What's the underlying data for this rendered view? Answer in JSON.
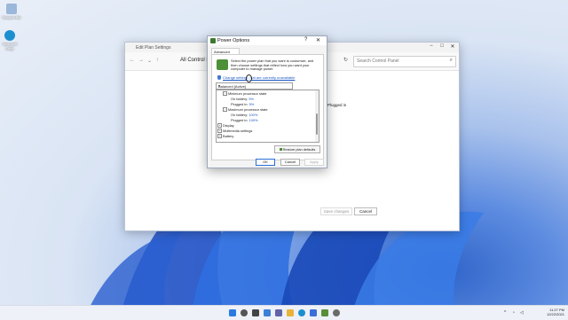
{
  "desktop": {
    "icons": [
      {
        "label": "Recycle Bin",
        "color": "#9bb7d9"
      },
      {
        "label": "Microsoft Edge",
        "color": "#1c8fd0"
      }
    ]
  },
  "control_panel": {
    "title": "Edit Plan Settings",
    "breadcrumb": "All Control P",
    "search_placeholder": "Search Control Panel",
    "plugged_in_label": "Plugged in",
    "save_label": "Save changes",
    "cancel_label": "Cancel"
  },
  "dialog": {
    "title": "Power Options",
    "help": "?",
    "close": "✕",
    "tab": "Advanced settings",
    "description": "Select the power plan that you want to customize, and then choose settings that reflect how you want your computer to manage power.",
    "change_link": "Change settings that are currently unavailable",
    "plan_selected": "Balanced [Active]",
    "tree": [
      {
        "label": "Minimum processor state",
        "indent": 1,
        "expander": "−",
        "value": ""
      },
      {
        "label": "On battery:",
        "indent": 2,
        "expander": "",
        "value": "5%"
      },
      {
        "label": "Plugged in:",
        "indent": 2,
        "expander": "",
        "value": "5%"
      },
      {
        "label": "Maximum processor state",
        "indent": 1,
        "expander": "−",
        "value": ""
      },
      {
        "label": "On battery:",
        "indent": 2,
        "expander": "",
        "value": "100%"
      },
      {
        "label": "Plugged in:",
        "indent": 2,
        "expander": "",
        "value": "100%"
      },
      {
        "label": "Display",
        "indent": 0,
        "expander": "+",
        "value": ""
      },
      {
        "label": "Multimedia settings",
        "indent": 0,
        "expander": "+",
        "value": ""
      },
      {
        "label": "Battery",
        "indent": 0,
        "expander": "+",
        "value": ""
      }
    ],
    "restore_label": "Restore plan defaults",
    "ok_label": "OK",
    "cancel_label": "Cancel",
    "apply_label": "Apply"
  },
  "taskbar": {
    "apps": [
      {
        "name": "start",
        "color": "#2a7ae2"
      },
      {
        "name": "search",
        "color": "#555555"
      },
      {
        "name": "task-view",
        "color": "#444444"
      },
      {
        "name": "widgets",
        "color": "#3b7fd9"
      },
      {
        "name": "chat",
        "color": "#6264a7"
      },
      {
        "name": "file-explorer",
        "color": "#e8b33a"
      },
      {
        "name": "edge",
        "color": "#1c8fd0"
      },
      {
        "name": "store",
        "color": "#3a6fd8"
      },
      {
        "name": "control-panel",
        "color": "#5a8f3a"
      },
      {
        "name": "settings",
        "color": "#6a6a6a"
      }
    ],
    "time": "11:27 PM",
    "date": "12/22/2021"
  }
}
